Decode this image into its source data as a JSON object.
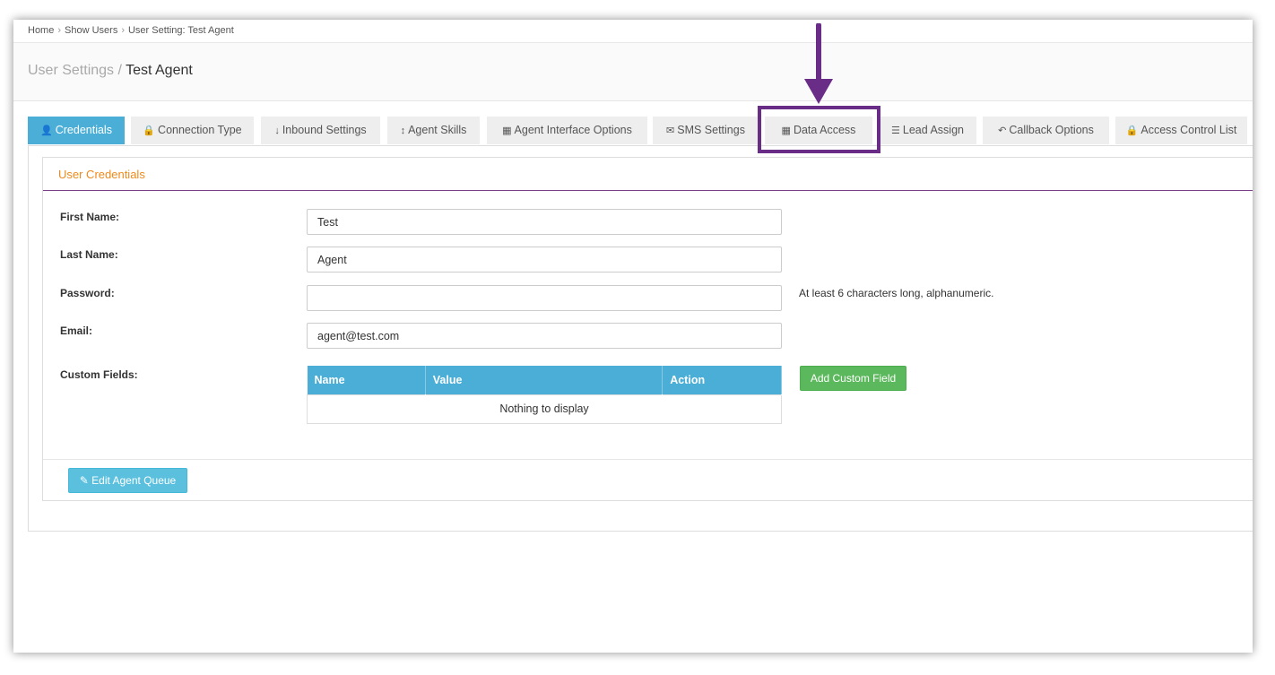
{
  "breadcrumb": {
    "home": "Home",
    "show_users": "Show Users",
    "current": "User Setting: Test Agent",
    "sep": "›"
  },
  "title": {
    "section": "User Settings",
    "sep": " / ",
    "name": "Test Agent"
  },
  "tabs": [
    {
      "label": "Credentials",
      "icon": "user-icon",
      "glyph": "👤"
    },
    {
      "label": "Connection Type",
      "icon": "lock-icon",
      "glyph": "🔒"
    },
    {
      "label": "Inbound Settings",
      "icon": "arrow-down-icon",
      "glyph": "↓"
    },
    {
      "label": "Agent Skills",
      "icon": "arrows-vertical-icon",
      "glyph": "↕"
    },
    {
      "label": "Agent Interface Options",
      "icon": "grid-icon",
      "glyph": "▦"
    },
    {
      "label": "SMS Settings",
      "icon": "envelope-icon",
      "glyph": "✉"
    },
    {
      "label": "Data Access",
      "icon": "grid-icon",
      "glyph": "▦"
    },
    {
      "label": "Lead Assign",
      "icon": "list-icon",
      "glyph": "☰"
    },
    {
      "label": "Callback Options",
      "icon": "reply-icon",
      "glyph": "↶"
    },
    {
      "label": "Access Control List",
      "icon": "lock-icon",
      "glyph": "🔒"
    }
  ],
  "panel": {
    "heading": "User Credentials"
  },
  "form": {
    "first_name_label": "First Name:",
    "first_name_value": "Test",
    "last_name_label": "Last Name:",
    "last_name_value": "Agent",
    "password_label": "Password:",
    "password_value": "",
    "password_hint": "At least 6 characters long, alphanumeric.",
    "email_label": "Email:",
    "email_value": "agent@test.com",
    "custom_fields_label": "Custom Fields:"
  },
  "custom_table": {
    "headers": [
      "Name",
      "Value",
      "Action"
    ],
    "empty": "Nothing to display"
  },
  "buttons": {
    "add_custom_field": "Add Custom Field",
    "edit_agent_queue": "Edit Agent Queue",
    "edit_icon": "✎"
  },
  "colors": {
    "accent": "#4aaed6",
    "success": "#5cb85c",
    "info": "#5bc0de",
    "heading": "#ee8a1c",
    "highlight": "#6a2d87"
  }
}
